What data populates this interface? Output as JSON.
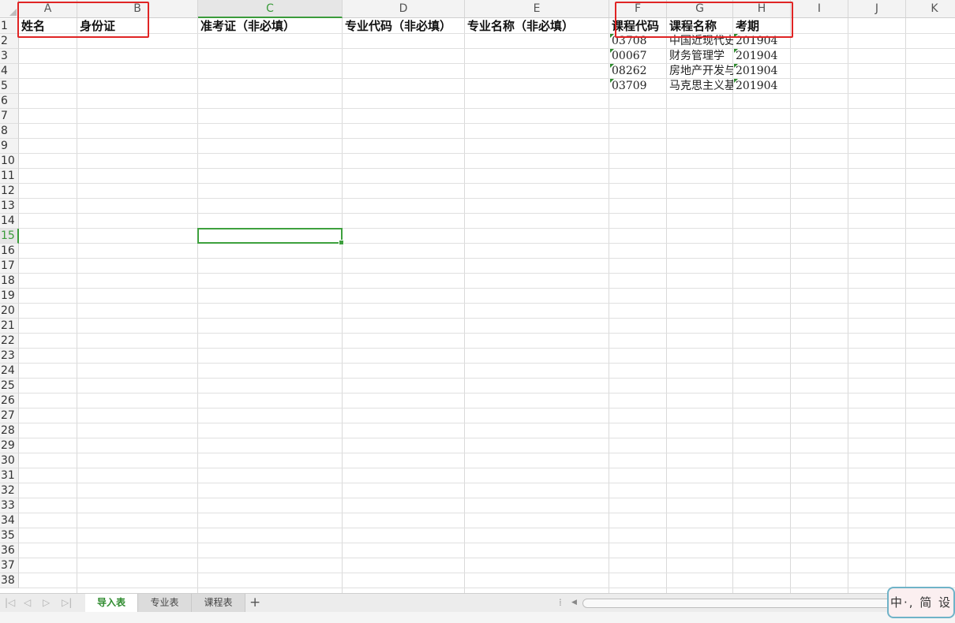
{
  "columns": [
    "A",
    "B",
    "C",
    "D",
    "E",
    "F",
    "G",
    "H",
    "I",
    "J",
    "K"
  ],
  "selected_column": "C",
  "rows": [
    "1",
    "2",
    "3",
    "4",
    "5",
    "6",
    "7",
    "8",
    "9",
    "10",
    "11",
    "12",
    "13",
    "14",
    "15",
    "16",
    "17",
    "18",
    "19",
    "20",
    "21",
    "22",
    "23",
    "24",
    "25",
    "26",
    "27",
    "28",
    "29",
    "30",
    "31",
    "32",
    "33",
    "34",
    "35",
    "36",
    "37",
    "38"
  ],
  "selected_row": "15",
  "header_row": {
    "A": "姓名",
    "B": "身份证",
    "C": "准考证（非必填）",
    "D": "专业代码（非必填）",
    "E": "专业名称（非必填）",
    "F": "课程代码",
    "G": "课程名称",
    "H": "考期"
  },
  "data_rows": [
    {
      "F": "03708",
      "G": "中国近现代史纲要",
      "H": "201904"
    },
    {
      "F": "00067",
      "G": "财务管理学",
      "H": "201904"
    },
    {
      "F": "08262",
      "G": "房地产开发与经营",
      "H": "201904"
    },
    {
      "F": "03709",
      "G": "马克思主义基本原理概论",
      "H": "201904"
    }
  ],
  "sheet_tabs": [
    "导入表",
    "专业表",
    "课程表"
  ],
  "active_tab": "导入表",
  "add_sheet_label": "+",
  "ime_label": "中·, 简 设",
  "colors": {
    "accent_green": "#3ea03e",
    "annotation_red": "#e02424"
  }
}
